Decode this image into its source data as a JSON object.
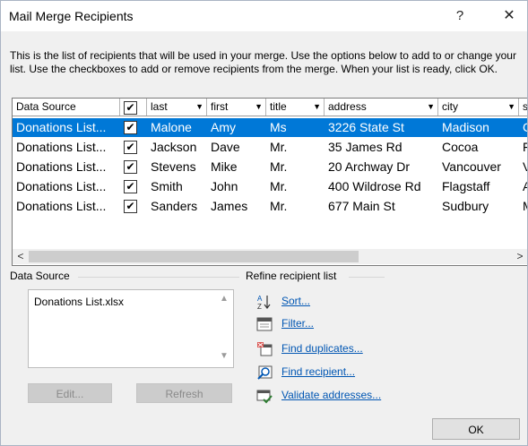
{
  "window": {
    "title": "Mail Merge Recipients",
    "help_glyph": "?",
    "close_glyph": "✕"
  },
  "description": "This is the list of recipients that will be used in your merge.  Use the options below to add to or change your list.  Use the checkboxes to add or remove recipients from the merge.  When your list is ready, click OK.",
  "grid": {
    "columns": [
      "Data Source",
      "",
      "last",
      "first",
      "title",
      "address",
      "city",
      "s"
    ],
    "rows": [
      {
        "source": "Donations List...",
        "checked": true,
        "last": "Malone",
        "first": "Amy",
        "title": "Ms",
        "address": "3226 State St",
        "city": "Madison",
        "s": "C",
        "selected": true
      },
      {
        "source": "Donations List...",
        "checked": true,
        "last": "Jackson",
        "first": "Dave",
        "title": "Mr.",
        "address": "35 James Rd",
        "city": "Cocoa",
        "s": "F",
        "selected": false
      },
      {
        "source": "Donations List...",
        "checked": true,
        "last": "Stevens",
        "first": "Mike",
        "title": "Mr.",
        "address": "20 Archway Dr",
        "city": "Vancouver",
        "s": "V",
        "selected": false
      },
      {
        "source": "Donations List...",
        "checked": true,
        "last": "Smith",
        "first": "John",
        "title": "Mr.",
        "address": "400 Wildrose Rd",
        "city": "Flagstaff",
        "s": "A",
        "selected": false
      },
      {
        "source": "Donations List...",
        "checked": true,
        "last": "Sanders",
        "first": "James",
        "title": "Mr.",
        "address": "677 Main St",
        "city": "Sudbury",
        "s": "M",
        "selected": false
      }
    ],
    "check_glyph": "✔",
    "sort_arrow": "▼",
    "scroll_left": "<",
    "scroll_right": ">"
  },
  "data_source": {
    "label": "Data Source",
    "items": [
      "Donations List.xlsx"
    ],
    "edit_label": "Edit...",
    "refresh_label": "Refresh"
  },
  "refine": {
    "label": "Refine recipient list",
    "items": [
      {
        "label": "Sort...",
        "icon": "sort-az-icon"
      },
      {
        "label": "Filter...",
        "icon": "filter-icon"
      },
      {
        "label": "Find duplicates...",
        "icon": "find-duplicates-icon"
      },
      {
        "label": "Find recipient...",
        "icon": "find-recipient-icon"
      },
      {
        "label": "Validate addresses...",
        "icon": "validate-addresses-icon"
      }
    ]
  },
  "ok_label": "OK",
  "colors": {
    "selection": "#0078d7",
    "link": "#0056b3",
    "dialog_bg": "#f0f0f0"
  }
}
